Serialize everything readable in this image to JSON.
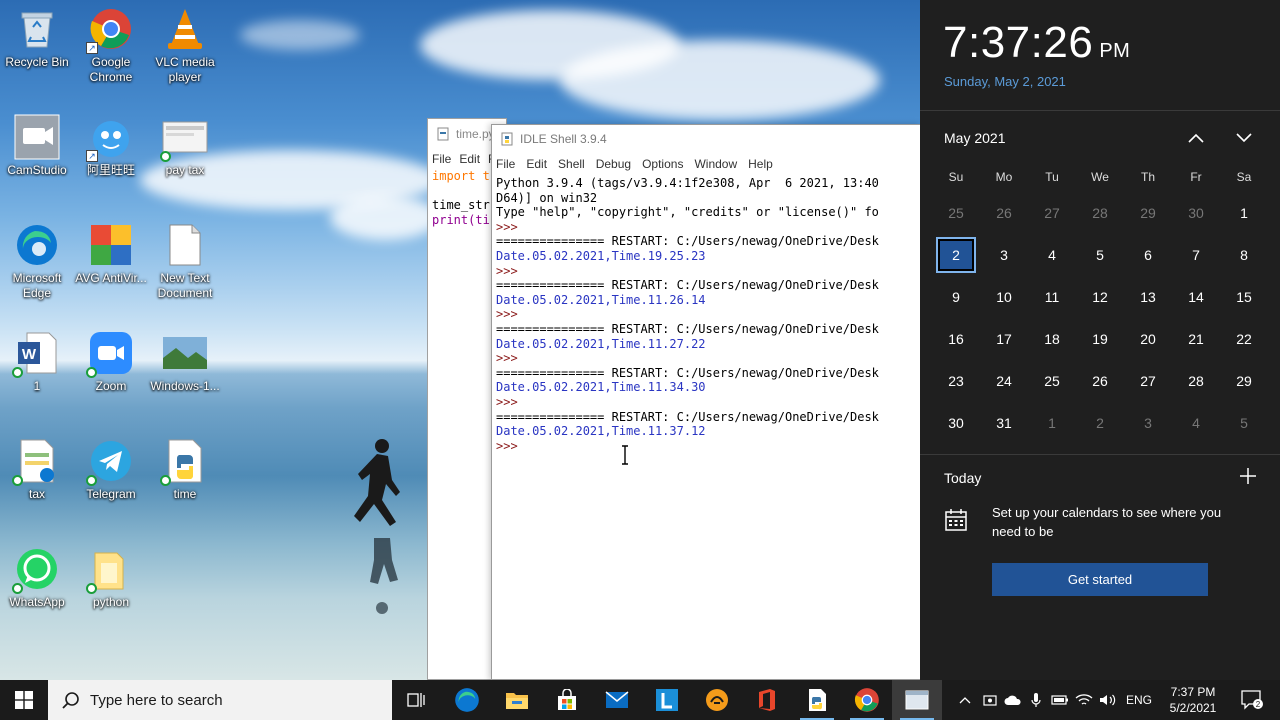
{
  "desktop": {
    "icons": [
      {
        "id": "recycle-bin",
        "label": "Recycle Bin"
      },
      {
        "id": "google-chrome",
        "label": "Google Chrome"
      },
      {
        "id": "vlc",
        "label": "VLC media player"
      },
      {
        "id": "camstudio",
        "label": "CamStudio"
      },
      {
        "id": "aliwangwang",
        "label": "阿里旺旺"
      },
      {
        "id": "pay-tax",
        "label": "pay tax"
      },
      {
        "id": "edge",
        "label": "Microsoft Edge"
      },
      {
        "id": "avg",
        "label": "AVG AntiVir..."
      },
      {
        "id": "new-text",
        "label": "New Text Document"
      },
      {
        "id": "word-1",
        "label": "1"
      },
      {
        "id": "zoom",
        "label": "Zoom"
      },
      {
        "id": "windows-1",
        "label": "Windows-1..."
      },
      {
        "id": "tax",
        "label": "tax"
      },
      {
        "id": "telegram",
        "label": "Telegram"
      },
      {
        "id": "time",
        "label": "time"
      },
      {
        "id": "whatsapp",
        "label": "WhatsApp"
      },
      {
        "id": "python-folder",
        "label": "python"
      }
    ]
  },
  "editor": {
    "title": "time.py",
    "menu": [
      "File",
      "Edit",
      "F"
    ],
    "lines": [
      "import t",
      "",
      "time_str",
      "print(ti"
    ]
  },
  "shell": {
    "title": "IDLE Shell 3.9.4",
    "menu": [
      "File",
      "Edit",
      "Shell",
      "Debug",
      "Options",
      "Window",
      "Help"
    ],
    "lines": [
      {
        "t": "Python 3.9.4 (tags/v3.9.4:1f2e308, Apr  6 2021, 13:40",
        "c": "out-black"
      },
      {
        "t": "D64)] on win32",
        "c": "out-black"
      },
      {
        "t": "Type \"help\", \"copyright\", \"credits\" or \"license()\" fo",
        "c": "out-black"
      },
      {
        "t": ">>> ",
        "c": "prompt"
      },
      {
        "t": "=============== RESTART: C:/Users/newag/OneDrive/Desk",
        "c": "out-black"
      },
      {
        "t": "Date.05.02.2021,Time.19.25.23",
        "c": "out-blue"
      },
      {
        "t": ">>> ",
        "c": "prompt"
      },
      {
        "t": "=============== RESTART: C:/Users/newag/OneDrive/Desk",
        "c": "out-black"
      },
      {
        "t": "Date.05.02.2021,Time.11.26.14",
        "c": "out-blue"
      },
      {
        "t": ">>> ",
        "c": "prompt"
      },
      {
        "t": "=============== RESTART: C:/Users/newag/OneDrive/Desk",
        "c": "out-black"
      },
      {
        "t": "Date.05.02.2021,Time.11.27.22",
        "c": "out-blue"
      },
      {
        "t": ">>> ",
        "c": "prompt"
      },
      {
        "t": "=============== RESTART: C:/Users/newag/OneDrive/Desk",
        "c": "out-black"
      },
      {
        "t": "Date.05.02.2021,Time.11.34.30",
        "c": "out-blue"
      },
      {
        "t": ">>> ",
        "c": "prompt"
      },
      {
        "t": "=============== RESTART: C:/Users/newag/OneDrive/Desk",
        "c": "out-black"
      },
      {
        "t": "Date.05.02.2021,Time.11.37.12",
        "c": "out-blue"
      },
      {
        "t": ">>> ",
        "c": "prompt"
      }
    ]
  },
  "flyout": {
    "time": "7:37:26",
    "ampm": "PM",
    "date": "Sunday, May 2, 2021",
    "month": "May 2021",
    "weekdays": [
      "Su",
      "Mo",
      "Tu",
      "We",
      "Th",
      "Fr",
      "Sa"
    ],
    "weeks": [
      [
        {
          "d": "25",
          "dim": true
        },
        {
          "d": "26",
          "dim": true
        },
        {
          "d": "27",
          "dim": true
        },
        {
          "d": "28",
          "dim": true
        },
        {
          "d": "29",
          "dim": true
        },
        {
          "d": "30",
          "dim": true
        },
        {
          "d": "1"
        }
      ],
      [
        {
          "d": "2",
          "today": true
        },
        {
          "d": "3"
        },
        {
          "d": "4"
        },
        {
          "d": "5"
        },
        {
          "d": "6"
        },
        {
          "d": "7"
        },
        {
          "d": "8"
        }
      ],
      [
        {
          "d": "9"
        },
        {
          "d": "10"
        },
        {
          "d": "11"
        },
        {
          "d": "12"
        },
        {
          "d": "13"
        },
        {
          "d": "14"
        },
        {
          "d": "15"
        }
      ],
      [
        {
          "d": "16"
        },
        {
          "d": "17"
        },
        {
          "d": "18"
        },
        {
          "d": "19"
        },
        {
          "d": "20"
        },
        {
          "d": "21"
        },
        {
          "d": "22"
        }
      ],
      [
        {
          "d": "23"
        },
        {
          "d": "24"
        },
        {
          "d": "25"
        },
        {
          "d": "26"
        },
        {
          "d": "27"
        },
        {
          "d": "28"
        },
        {
          "d": "29"
        }
      ],
      [
        {
          "d": "30"
        },
        {
          "d": "31"
        },
        {
          "d": "1",
          "dim": true
        },
        {
          "d": "2",
          "dim": true
        },
        {
          "d": "3",
          "dim": true
        },
        {
          "d": "4",
          "dim": true
        },
        {
          "d": "5",
          "dim": true
        }
      ]
    ],
    "today_label": "Today",
    "setup_text": "Set up your calendars to see where you need to be",
    "get_started": "Get started"
  },
  "taskbar": {
    "search_placeholder": "Type here to search",
    "language": "ENG",
    "clock_time": "7:37 PM",
    "clock_date": "5/2/2021",
    "notification_count": "2"
  },
  "colors": {
    "accent": "#215396",
    "date_link": "#5b9bd8",
    "flyout_bg": "#1f1f1f",
    "taskbar_bg": "#1b1b1b",
    "shell_output": "#2a35c2"
  }
}
